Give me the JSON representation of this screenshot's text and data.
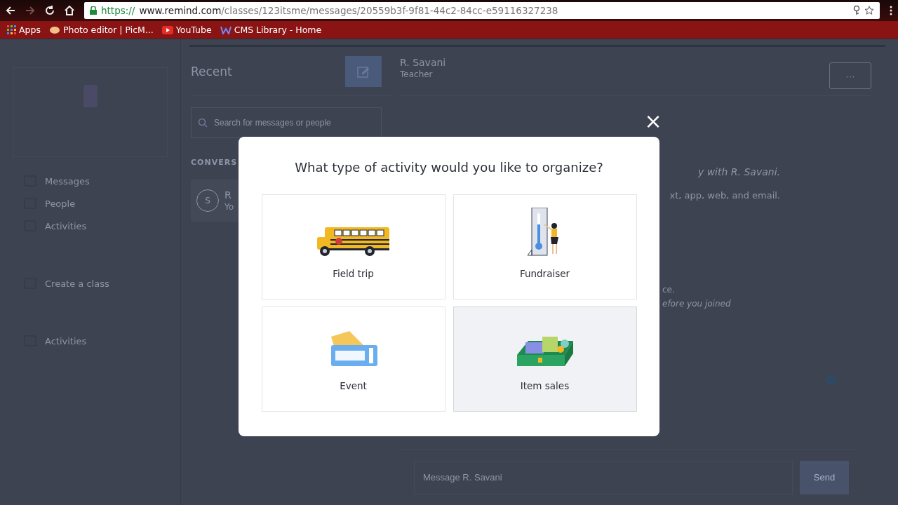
{
  "browser": {
    "url": {
      "scheme": "https://",
      "host": "www.remind.com",
      "path": "/classes/123itsme/messages/20559b3f-9f81-44c2-84cc-e59116327238"
    },
    "bookmarks": [
      {
        "label": "Apps",
        "kind": "apps"
      },
      {
        "label": "Photo editor | PicM...",
        "kind": "photo"
      },
      {
        "label": "YouTube",
        "kind": "youtube"
      },
      {
        "label": "CMS Library - Home",
        "kind": "weebly"
      }
    ]
  },
  "sidebar": {
    "items": [
      {
        "label": "Messages"
      },
      {
        "label": "People"
      },
      {
        "label": "Activities"
      },
      {
        "label": "Create a class"
      },
      {
        "label": "Activities"
      }
    ]
  },
  "conversations": {
    "title": "Recent",
    "search": {
      "placeholder": "Search for messages or people"
    },
    "section_heading": "CONVERS",
    "items": [
      {
        "avatar": "S",
        "name": "R",
        "preview": "Yo"
      }
    ]
  },
  "chat": {
    "name": "R. Savani",
    "role": "Teacher",
    "more": "···",
    "intro": "y with R. Savani.",
    "intro_sub": "xt, app, web, and email.",
    "note": "ce.",
    "note_sub": "efore you joined",
    "composer": {
      "placeholder": "Message R. Savani"
    },
    "send": "Send"
  },
  "modal": {
    "title": "What type of activity would you like to organize?",
    "close": "×",
    "options": [
      {
        "label": "Field trip",
        "kind": "bus",
        "hovered": false
      },
      {
        "label": "Fundraiser",
        "kind": "thermometer",
        "hovered": false
      },
      {
        "label": "Event",
        "kind": "ticket",
        "hovered": false
      },
      {
        "label": "Item sales",
        "kind": "money",
        "hovered": true
      }
    ]
  }
}
